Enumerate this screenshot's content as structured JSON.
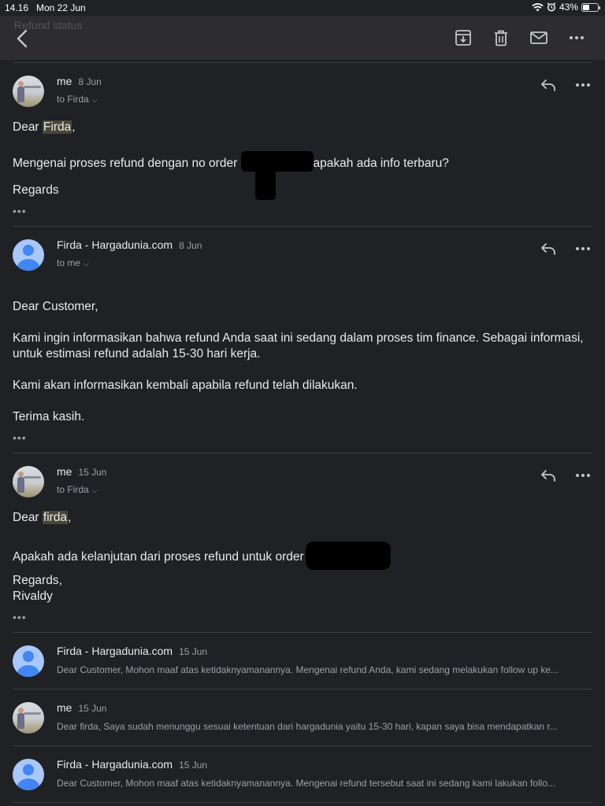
{
  "status_bar": {
    "time": "14.16",
    "date": "Mon 22 Jun",
    "battery": "43%"
  },
  "toolbar": {
    "ghost_title": "Refund status"
  },
  "messages": [
    {
      "sender": "me",
      "date": "8 Jun",
      "to": "to Firda",
      "greeting_prefix": "Dear ",
      "greeting_name": "Firda",
      "greeting_suffix": ",",
      "line1_prefix": "Mengenai proses refund dengan no order ",
      "line1_suffix": "apakah ada info terbaru?",
      "closing": "Regards"
    },
    {
      "sender": "Firda - Hargadunia.com",
      "date": "8 Jun",
      "to": "to me",
      "greeting": "Dear Customer,",
      "para1": "Kami ingin informasikan bahwa refund Anda saat ini sedang dalam proses tim finance. Sebagai informasi, untuk estimasi refund adalah 15-30 hari kerja.",
      "para2": "Kami akan informasikan kembali apabila refund telah dilakukan.",
      "closing": "Terima kasih."
    },
    {
      "sender": "me",
      "date": "15 Jun",
      "to": "to Firda",
      "greeting_prefix": "Dear ",
      "greeting_name": "firda",
      "greeting_suffix": ",",
      "line1_prefix": "Apakah ada kelanjutan dari proses refund untuk order",
      "closing1": "Regards,",
      "closing2": "Rivaldy"
    }
  ],
  "collapsed": [
    {
      "sender": "Firda - Hargadunia.com",
      "date": "15 Jun",
      "snippet": "Dear Customer, Mohon maaf atas ketidaknyamanannya. Mengenai refund Anda, kami sedang melakukan follow up ke..."
    },
    {
      "sender": "me",
      "date": "15 Jun",
      "snippet": "Dear firda, Saya sudah menunggu sesuai ketentuan dari hargadunia yaitu 15-30 hari, kapan saya bisa mendapatkan r..."
    },
    {
      "sender": "Firda - Hargadunia.com",
      "date": "15 Jun",
      "snippet": "Dear Customer, Mohon maaf atas ketidaknyamanannya. Mengenai refund tersebut saat ini sedang kami lakukan follo..."
    }
  ],
  "icons": {
    "back": "chevron-left-icon",
    "archive": "archive-icon",
    "delete": "trash-icon",
    "mail": "mail-icon",
    "more": "more-horizontal-icon",
    "reply": "reply-icon"
  },
  "colors": {
    "background": "#202124",
    "toolbar": "#2d2c30",
    "highlight": "#4a4636",
    "avatar_blue": "#4285f4"
  }
}
